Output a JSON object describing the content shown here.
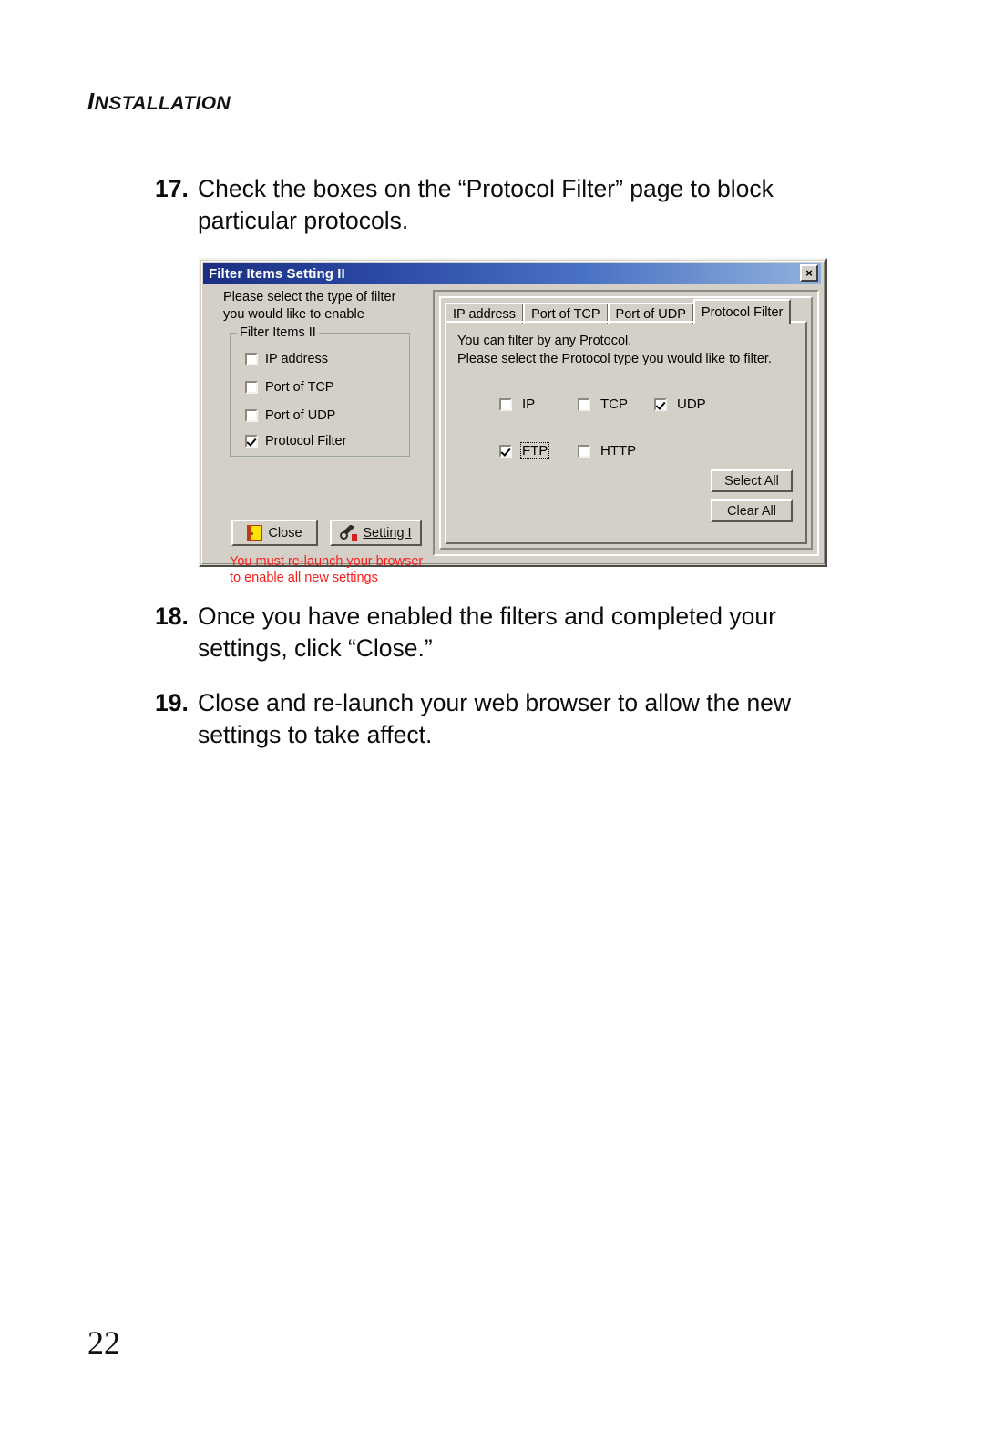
{
  "page": {
    "running_head": "INSTALLATION",
    "running_head_initial": "I",
    "running_head_rest": "NSTALLATION",
    "folio": "22"
  },
  "steps": [
    {
      "number": "17.",
      "text": "Check the boxes on the “Protocol Filter” page to block particular protocols."
    },
    {
      "number": "18.",
      "text": "Once you have enabled the filters and completed your settings, click “Close.”"
    },
    {
      "number": "19.",
      "text": "Close and re-launch your web browser to allow the new settings to take affect."
    }
  ],
  "dialog": {
    "title": "Filter Items Setting II",
    "close_icon": "×",
    "close_icon_label": "window-close",
    "left_pane": {
      "intro_line1": "Please select the type of filter",
      "intro_line2": "you would like to enable",
      "group_label": "Filter Items II",
      "items": [
        {
          "label": "IP address",
          "checked": false
        },
        {
          "label": "Port of TCP",
          "checked": false
        },
        {
          "label": "Port of UDP",
          "checked": false
        },
        {
          "label": "Protocol Filter",
          "checked": true
        }
      ],
      "close_button": "Close",
      "close_button_icon": "door-icon",
      "setting_button": "Setting I",
      "setting_button_icon": "tool-magnifier-icon",
      "warning_line1": "You must re-launch your browser",
      "warning_line2": "to enable all new settings",
      "warning_color": "#ff1a1a"
    },
    "right_pane": {
      "tabs": [
        {
          "label": "IP address",
          "active": false
        },
        {
          "label": "Port of TCP",
          "active": false
        },
        {
          "label": "Port of UDP",
          "active": false
        },
        {
          "label": "Protocol Filter",
          "active": true
        }
      ],
      "desc_line1": "You can filter by any Protocol.",
      "desc_line2": "Please select the Protocol type you would like to filter.",
      "protocols": [
        {
          "label": "IP",
          "checked": false,
          "focused": false
        },
        {
          "label": "TCP",
          "checked": false,
          "focused": false
        },
        {
          "label": "UDP",
          "checked": true,
          "focused": false
        },
        {
          "label": "FTP",
          "checked": true,
          "focused": true
        },
        {
          "label": "HTTP",
          "checked": false,
          "focused": false
        }
      ],
      "select_all_button": "Select All",
      "clear_all_button": "Clear  All"
    },
    "colors": {
      "face": "#d4d0c8",
      "titlebar_dark": "#1b2f82",
      "titlebar_light": "#8fb2dd",
      "warning": "#ff1a1a"
    }
  }
}
